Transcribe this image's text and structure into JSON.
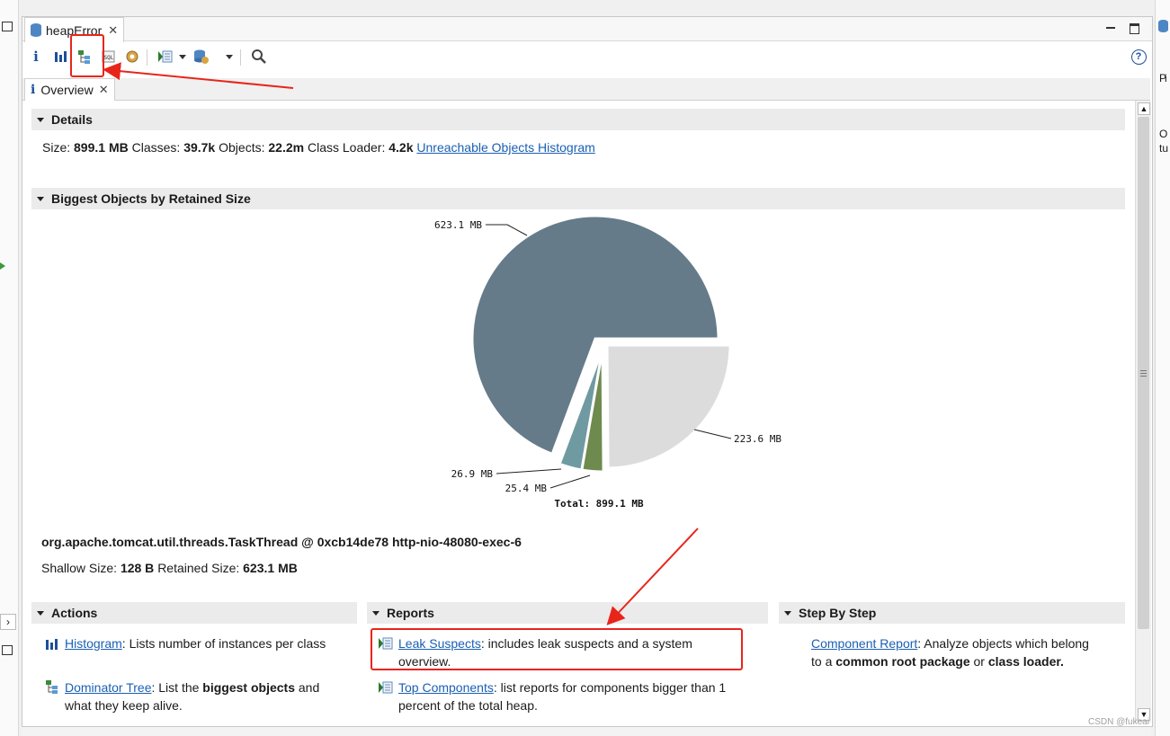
{
  "editor": {
    "tab_title": "heapError",
    "close_glyph": "✕"
  },
  "inner_tab": {
    "label": "Overview"
  },
  "details": {
    "heading": "Details",
    "size_label": "Size:",
    "size": "899.1 MB",
    "classes_label": "Classes:",
    "classes": "39.7k",
    "objects_label": "Objects:",
    "objects": "22.2m",
    "loader_label": "Class Loader:",
    "loader": "4.2k",
    "histogram_link": "Unreachable Objects Histogram"
  },
  "biggest": {
    "heading": "Biggest Objects by Retained Size",
    "object_title": "org.apache.tomcat.util.threads.TaskThread @ 0xcb14de78 http-nio-48080-exec-6",
    "shallow_label": "Shallow Size:",
    "shallow": "128 B",
    "retained_label": "Retained Size:",
    "retained": "623.1 MB"
  },
  "chart_data": {
    "type": "pie",
    "slices": [
      {
        "label": "623.1 MB",
        "value": 623.1,
        "color": "#657b8a"
      },
      {
        "label": "26.9 MB",
        "value": 26.9,
        "color": "#6f9aa2"
      },
      {
        "label": "25.4 MB",
        "value": 25.4,
        "color": "#6e8a4e"
      },
      {
        "label": "223.6 MB",
        "value": 223.6,
        "color": "#dcdcdc"
      }
    ],
    "total_label": "Total: 899.1 MB"
  },
  "actions": {
    "heading": "Actions",
    "histogram_link": "Histogram",
    "histogram_desc": ": Lists number of instances per class",
    "dominator_link": "Dominator Tree",
    "dominator_desc_1": ": List the ",
    "dominator_bold": "biggest objects",
    "dominator_desc_2": " and what they keep alive."
  },
  "reports": {
    "heading": "Reports",
    "leak_link": "Leak Suspects",
    "leak_desc": ": includes leak suspects and a system overview.",
    "top_link": "Top Components",
    "top_desc": ": list reports for components bigger than 1 percent of the total heap."
  },
  "steps": {
    "heading": "Step By Step",
    "component_link": "Component Report",
    "component_desc_1": ": Analyze objects which belong to a ",
    "component_bold_1": "common root package",
    "component_desc_2": " or ",
    "component_bold_2": "class loader."
  },
  "right_strip": {
    "chars": [
      "P",
      "i",
      "O",
      "tu"
    ]
  },
  "watermark": "CSDN @fukeai",
  "colors": {
    "annotation": "#e8251b",
    "link": "#1a5fb4",
    "pie_big": "#657b8a"
  }
}
